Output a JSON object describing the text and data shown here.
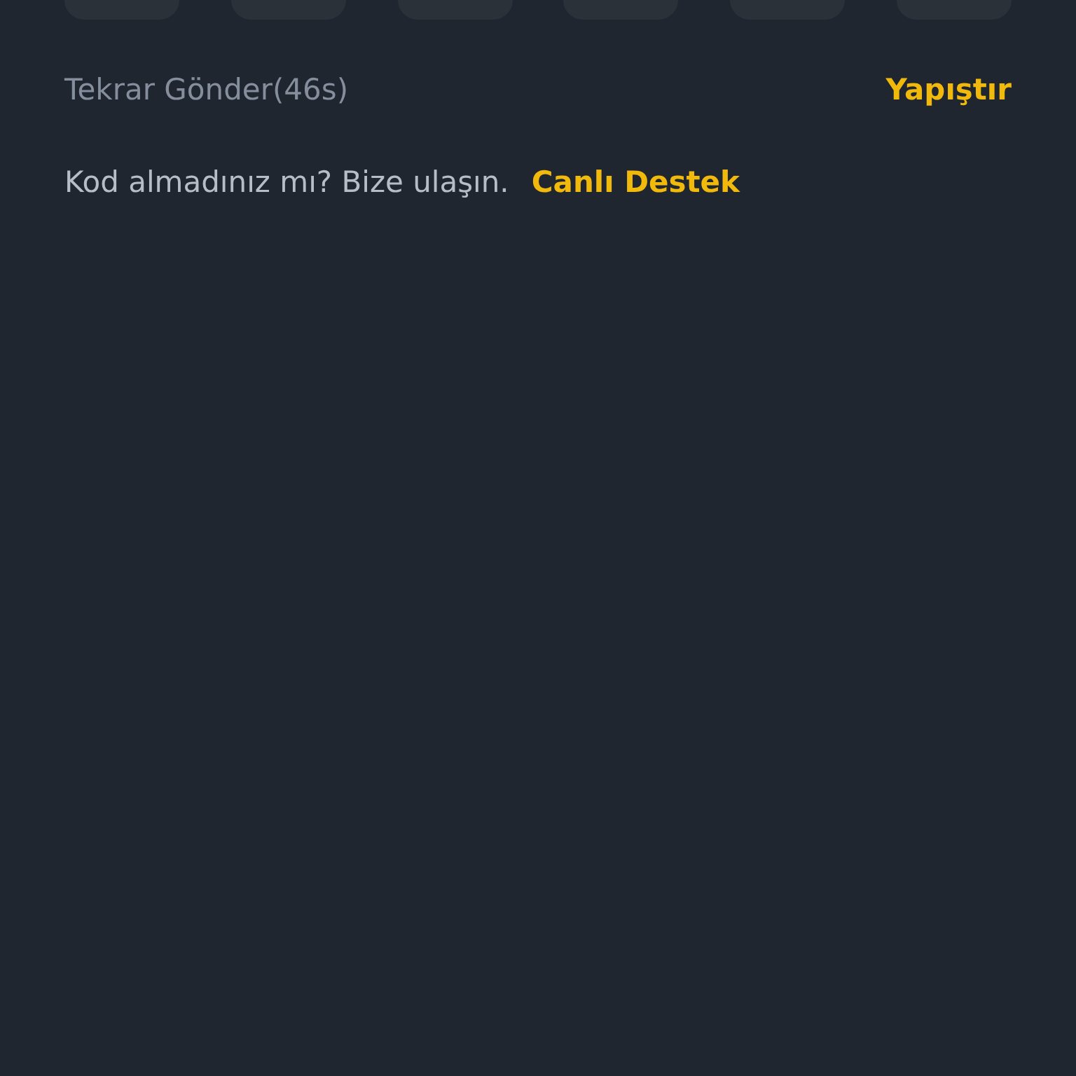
{
  "code_fields": [
    {
      "focused": false
    },
    {
      "focused": false
    },
    {
      "focused": false
    },
    {
      "focused": false
    },
    {
      "focused": false
    },
    {
      "focused": false
    }
  ],
  "resend": {
    "label": "Tekrar Gönder(46s)",
    "disabled": true
  },
  "paste": {
    "label": "Yapıştır"
  },
  "help": {
    "text": "Kod almadınız mı? Bize ulaşın.",
    "link": "Canlı Destek"
  }
}
